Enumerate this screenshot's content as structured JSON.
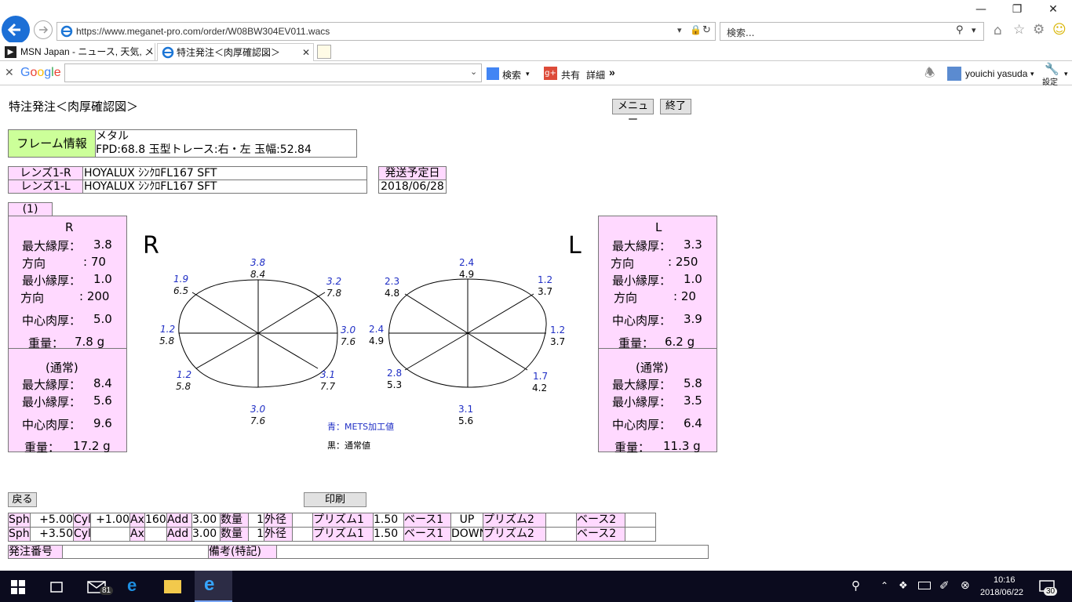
{
  "browser": {
    "url": "https://www.meganet-pro.com/order/W08BW304EV011.wacs",
    "search_placeholder": "検索...",
    "tabs": [
      {
        "label": "MSN Japan - ニュース, 天気, メー..."
      },
      {
        "label": "特注発注＜肉厚確認図＞"
      }
    ],
    "google": {
      "logo": "Google",
      "search_label": "検索",
      "share_label": "共有",
      "detail_label": "詳細",
      "more_label": "»",
      "user": "youichi yasuda",
      "settings_label": "設定"
    }
  },
  "page": {
    "title": "特注発注＜肉厚確認図＞",
    "menu_button": "メニュー",
    "exit_button": "終了",
    "frame_label": "フレーム情報",
    "frame_line1": "メタル",
    "frame_line2": "FPD:68.8 玉型トレース:右・左 玉幅:52.84",
    "lens_r_label": "レンズ1-R",
    "lens_r_value": "HOYALUX ｼﾝｸﾛFL167 SFT",
    "lens_l_label": "レンズ1-L",
    "lens_l_value": "HOYALUX ｼﾝｸﾛFL167 SFT",
    "ship_label": "発送予定日",
    "ship_value": "2018/06/28",
    "tab_index": "(1)",
    "right_panel": {
      "title": "R",
      "max_label": "最大縁厚：",
      "max": "3.8",
      "dir1_label": "方向",
      "dir1": ": 70",
      "min_label": "最小縁厚：",
      "min": "1.0",
      "dir2_label": "方向",
      "dir2": ": 200",
      "center_label": "中心肉厚：",
      "center": "5.0",
      "weight_label": "重量：",
      "weight": "7.8 g",
      "normal_title": "(通常)",
      "n_max_label": "最大縁厚：",
      "n_max": "8.4",
      "n_min_label": "最小縁厚：",
      "n_min": "5.6",
      "n_center_label": "中心肉厚：",
      "n_center": "9.6",
      "n_weight_label": "重量：",
      "n_weight": "17.2 g"
    },
    "left_panel": {
      "title": "L",
      "max_label": "最大縁厚：",
      "max": "3.3",
      "dir1_label": "方向",
      "dir1": ": 250",
      "min_label": "最小縁厚：",
      "min": "1.0",
      "dir2_label": "方向",
      "dir2": ": 20",
      "center_label": "中心肉厚：",
      "center": "3.9",
      "weight_label": "重量：",
      "weight": "6.2 g",
      "normal_title": "(通常)",
      "n_max_label": "最大縁厚：",
      "n_max": "5.8",
      "n_min_label": "最小縁厚：",
      "n_min": "3.5",
      "n_center_label": "中心肉厚：",
      "n_center": "6.4",
      "n_weight_label": "重量：",
      "n_weight": "11.3 g"
    },
    "r_big": "R",
    "l_big": "L",
    "r_diagram": {
      "top": [
        "3.8",
        "8.4"
      ],
      "top_right": [
        "3.2",
        "7.8"
      ],
      "right": [
        "3.0",
        "7.6"
      ],
      "bottom_right": [
        "3.1",
        "7.7"
      ],
      "bottom": [
        "3.0",
        "7.6"
      ],
      "bottom_left": [
        "1.2",
        "5.8"
      ],
      "left": [
        "1.2",
        "5.8"
      ],
      "top_left": [
        "1.9",
        "6.5"
      ]
    },
    "l_diagram": {
      "top": [
        "2.4",
        "4.9"
      ],
      "top_right": [
        "1.2",
        "3.7"
      ],
      "right": [
        "1.2",
        "3.7"
      ],
      "bottom_right": [
        "1.7",
        "4.2"
      ],
      "bottom": [
        "3.1",
        "5.6"
      ],
      "bottom_left": [
        "2.8",
        "5.3"
      ],
      "left": [
        "2.4",
        "4.9"
      ],
      "top_left": [
        "2.3",
        "4.8"
      ]
    },
    "legend_blue": "青：METS加工値",
    "legend_black": "黒：通常値",
    "back_button": "戻る",
    "print_button": "印刷",
    "rx_rows": [
      [
        "Sph",
        "+5.00",
        "Cyl",
        "+1.00",
        "Ax",
        "160",
        "Add",
        "3.00",
        "数量",
        "1",
        "外径",
        "",
        "プリズム1",
        "1.50",
        "ベース1",
        "UP",
        "プリズム2",
        "",
        "ベース2",
        ""
      ],
      [
        "Sph",
        "+3.50",
        "Cyl",
        "",
        "Ax",
        "",
        "Add",
        "3.00",
        "数量",
        "1",
        "外径",
        "",
        "プリズム1",
        "1.50",
        "ベース1",
        "DOWN",
        "プリズム2",
        "",
        "ベース2",
        ""
      ]
    ],
    "order_label": "発注番号",
    "order_value": "",
    "remarks_label": "備考(特記)",
    "remarks_value": ""
  },
  "taskbar": {
    "mail_badge": "81",
    "time": "10:16",
    "date": "2018/06/22",
    "notif_badge": "30"
  }
}
